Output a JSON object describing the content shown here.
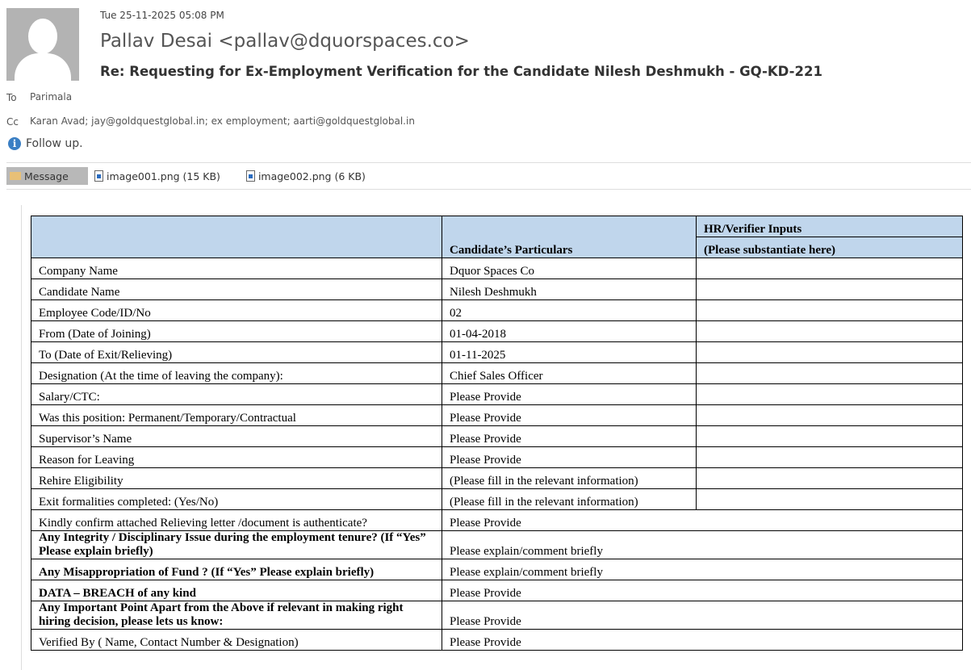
{
  "header": {
    "date": "Tue 25-11-2025 05:08 PM",
    "from": "Pallav Desai <pallav@dquorspaces.co>",
    "subject": "Re: Requesting for Ex-Employment Verification for the Candidate Nilesh Deshmukh - GQ-KD-221",
    "to_label": "To",
    "to": "Parimala",
    "cc_label": "Cc",
    "cc": "Karan Avad; jay@goldquestglobal.in; ex employment; aarti@goldquestglobal.in",
    "followup": "Follow up."
  },
  "tabs": {
    "message": "Message",
    "attachments": [
      "image001.png (15 KB)",
      "image002.png (6 KB)"
    ]
  },
  "table": {
    "col2_header": "Candidate’s Particulars",
    "col3_header_1": "HR/Verifier Inputs",
    "col3_header_2": "(Please substantiate here)",
    "rows": [
      {
        "label": "Company Name",
        "value": "Dquor Spaces Co"
      },
      {
        "label": "Candidate Name",
        "value": "Nilesh Deshmukh"
      },
      {
        "label": "Employee Code/ID/No",
        "value": "02"
      },
      {
        "label": "From (Date of Joining)",
        "value": "01-04-2018"
      },
      {
        "label": "To (Date of Exit/Relieving)",
        "value": "01-11-2025"
      },
      {
        "label": "Designation (At the time of leaving the company):",
        "value": "Chief Sales Officer"
      },
      {
        "label": "Salary/CTC:",
        "value": "Please Provide"
      },
      {
        "label": "Was this position: Permanent/Temporary/Contractual",
        "value": "Please Provide"
      },
      {
        "label": "Supervisor’s Name",
        "value": "Please Provide"
      },
      {
        "label": "Reason for Leaving",
        "value": "Please Provide"
      },
      {
        "label": "Rehire Eligibility",
        "value": "(Please fill in the relevant information)"
      },
      {
        "label": "Exit formalities completed: (Yes/No)",
        "value": "(Please fill in the relevant information)"
      }
    ],
    "wide_rows": [
      {
        "label": "Kindly confirm attached Relieving letter /document is authenticate?",
        "value": "Please Provide",
        "bold": false
      },
      {
        "label": "Any Integrity / Disciplinary Issue during the employment tenure? (If “Yes” Please explain briefly)",
        "value": "Please explain/comment briefly",
        "bold": true
      },
      {
        "label": "Any Misappropriation of Fund ? (If “Yes” Please explain briefly)",
        "value": "Please explain/comment briefly",
        "bold": true
      },
      {
        "label": "DATA – BREACH of any kind",
        "value": "Please Provide",
        "bold": true
      },
      {
        "label": "Any Important Point Apart from the Above if relevant in making right hiring decision, please lets us know:",
        "value": "Please Provide",
        "bold": true
      },
      {
        "label": "Verified By ( Name, Contact Number & Designation)",
        "value": "Please Provide",
        "bold": false
      }
    ]
  }
}
